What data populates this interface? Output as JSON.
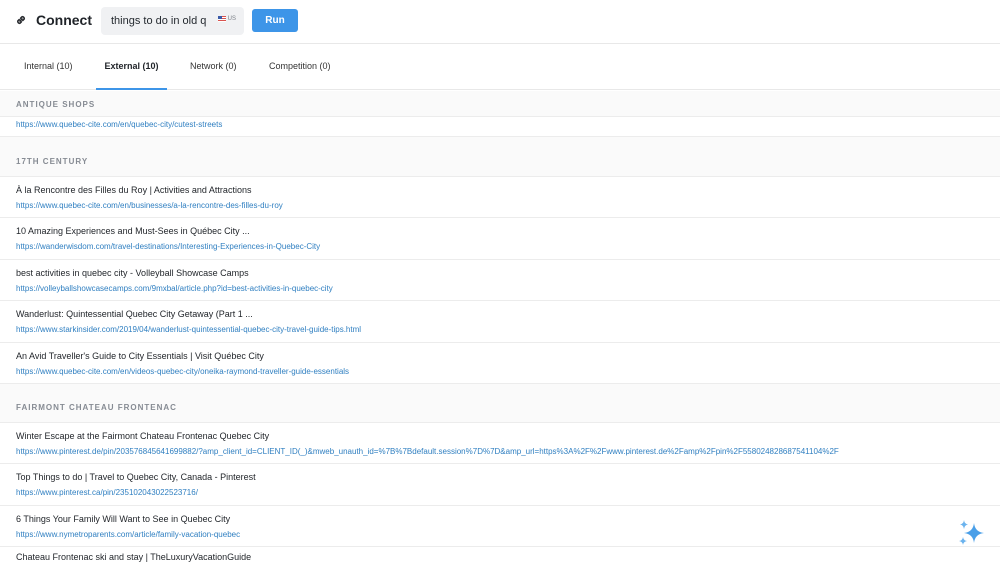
{
  "header": {
    "title": "Connect",
    "search_value": "things to do in old quebec city",
    "locale": "US",
    "run_label": "Run"
  },
  "tabs": [
    {
      "label": "Internal (10)"
    },
    {
      "label": "External (10)"
    },
    {
      "label": "Network (0)"
    },
    {
      "label": "Competition (0)"
    }
  ],
  "sections": [
    {
      "label": "ANTIQUE SHOPS",
      "results": [
        {
          "title": "",
          "url": "https://www.quebec-cite.com/en/quebec-city/cutest-streets"
        }
      ]
    },
    {
      "label": "17TH CENTURY",
      "results": [
        {
          "title": "À la Rencontre des Filles du Roy | Activities and Attractions",
          "url": "https://www.quebec-cite.com/en/businesses/a-la-rencontre-des-filles-du-roy"
        },
        {
          "title": "10 Amazing Experiences and Must-Sees in Québec City ...",
          "url": "https://wanderwisdom.com/travel-destinations/Interesting-Experiences-in-Quebec-City"
        },
        {
          "title": "best activities in quebec city - Volleyball Showcase Camps",
          "url": "https://volleyballshowcasecamps.com/9mxbal/article.php?id=best-activities-in-quebec-city"
        },
        {
          "title": "Wanderlust: Quintessential Quebec City Getaway (Part 1 ...",
          "url": "https://www.starkinsider.com/2019/04/wanderlust-quintessential-quebec-city-travel-guide-tips.html"
        },
        {
          "title": "An Avid Traveller's Guide to City Essentials | Visit Québec City",
          "url": "https://www.quebec-cite.com/en/videos-quebec-city/oneika-raymond-traveller-guide-essentials"
        }
      ]
    },
    {
      "label": "FAIRMONT CHATEAU FRONTENAC",
      "results": [
        {
          "title": "Winter Escape at the Fairmont Chateau Frontenac Quebec City",
          "url": "https://www.pinterest.de/pin/203576845641699882/?amp_client_id=CLIENT_ID(_)&mweb_unauth_id=%7B%7Bdefault.session%7D%7D&amp_url=https%3A%2F%2Fwww.pinterest.de%2Famp%2Fpin%2F558024828687541104%2F"
        },
        {
          "title": "Top Things to do | Travel to Quebec City, Canada - Pinterest",
          "url": "https://www.pinterest.ca/pin/235102043022523716/"
        },
        {
          "title": "6 Things Your Family Will Want to See in Quebec City",
          "url": "https://www.nymetroparents.com/article/family-vacation-quebec"
        },
        {
          "title": "Chateau Frontenac ski and stay | TheLuxuryVacationGuide",
          "url": ""
        }
      ]
    }
  ],
  "colors": {
    "accent": "#3d95e8",
    "link": "#2f7fc1",
    "section_label": "#868b93"
  },
  "icons": {
    "brand": "link-icon",
    "assistant": "sparkle-icon"
  }
}
